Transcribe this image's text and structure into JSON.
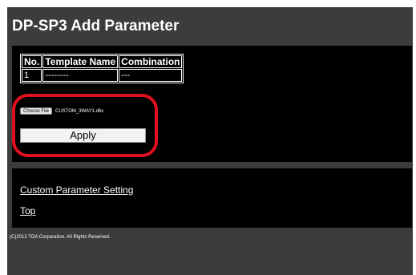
{
  "page": {
    "title": "DP-SP3 Add Parameter"
  },
  "table": {
    "headers": [
      "No.",
      "Template Name",
      "Combination"
    ],
    "rows": [
      [
        "1",
        "--------",
        "---"
      ]
    ]
  },
  "file_input": {
    "button_label": "Choose File",
    "file_name": "CUSTOM_3WAY1.d6x"
  },
  "apply": {
    "label": "Apply"
  },
  "highlight": {
    "color": "#e0101e"
  },
  "links": {
    "custom_parameter_setting": "Custom Parameter Setting",
    "top": "Top"
  },
  "footer": {
    "copyright": "(C)2012 TOA Corporation. All Rights Reserved."
  },
  "colors": {
    "frame_background": "#3c3c3c",
    "panel_background": "#000000",
    "text": "#ffffff"
  }
}
